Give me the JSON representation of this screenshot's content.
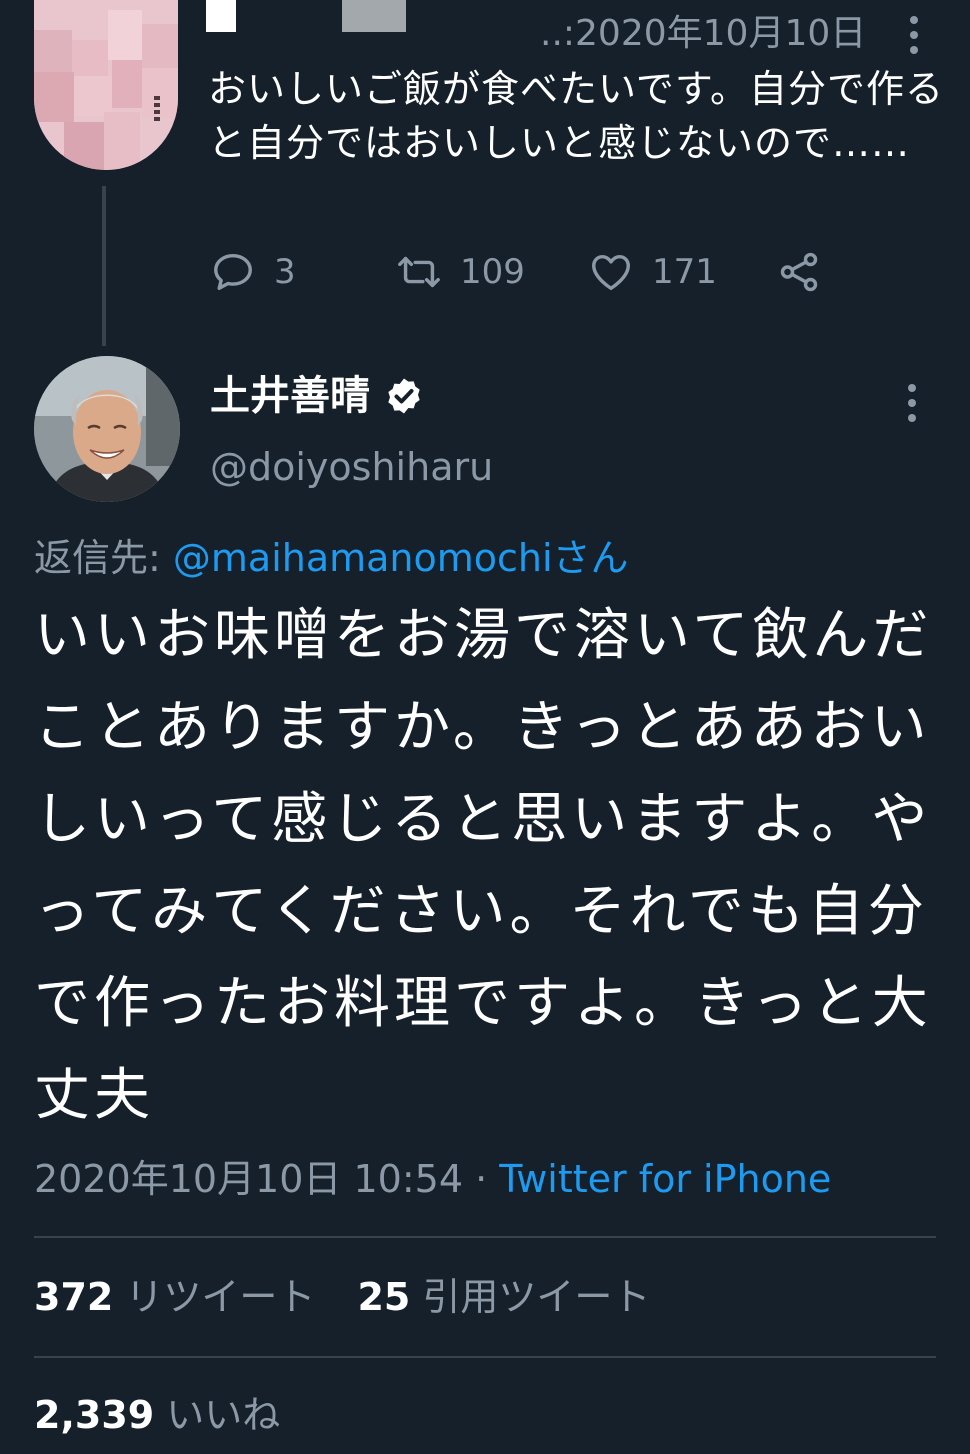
{
  "parent_tweet": {
    "timestamp": "2020年10月10日",
    "time_prefix": "..:",
    "text": "おいしいご飯が食べたいです。自分で作ると自分ではおいしいと感じないので……",
    "reply_count": "3",
    "retweet_count": "109",
    "like_count": "171",
    "icons": [
      "reply-icon",
      "retweet-icon",
      "like-icon",
      "share-icon",
      "more-icon"
    ]
  },
  "main_tweet": {
    "author_name": "土井善晴",
    "handle": "@doiyoshiharu",
    "reply_label": "返信先: ",
    "reply_mention": "@maihamanomochiさん",
    "text": "いいお味噌をお湯で溶いて飲んだことありますか。きっとああおいしいって感じると思いますよ。やってみてください。それでも自分で作ったお料理ですよ。きっと大丈夫",
    "timestamp": "2020年10月10日 10:54",
    "separator": " · ",
    "source": "Twitter for iPhone",
    "retweets": "372",
    "retweets_label": "リツイート",
    "quote_tweets": "25",
    "quote_tweets_label": "引用ツイート",
    "likes": "2,339",
    "likes_label": "いいね"
  },
  "colors": {
    "background": "#15202b",
    "text": "#ffffff",
    "secondary_text": "#8b98a5",
    "accent": "#1d9bf0",
    "divider": "#38444d"
  }
}
